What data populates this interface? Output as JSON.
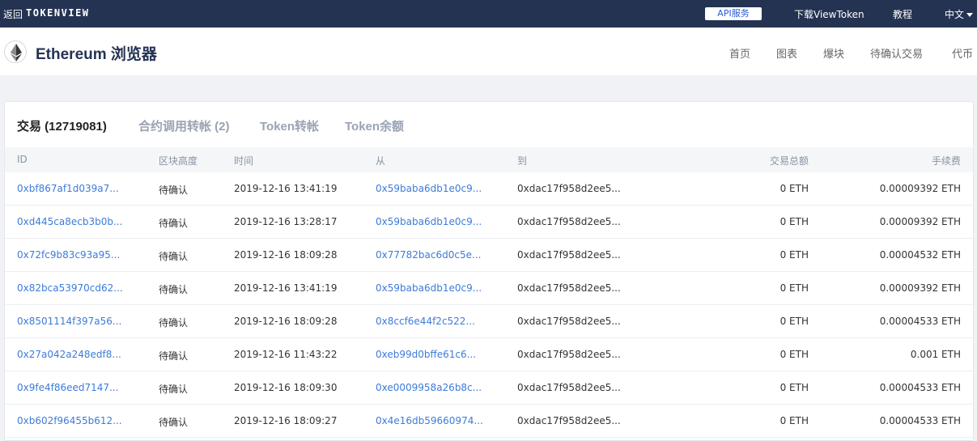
{
  "topbar": {
    "back": "返回",
    "brand": "TOKENVIEW",
    "api": "API服务",
    "download": "下载ViewToken",
    "tutorial": "教程",
    "language": "中文"
  },
  "header": {
    "title": "Ethereum 浏览器",
    "nav": [
      "首页",
      "图表",
      "爆块",
      "待确认交易",
      "代币"
    ]
  },
  "tabs": [
    "交易 (12719081)",
    "合约调用转帐 (2)",
    "Token转帐",
    "Token余额"
  ],
  "table": {
    "columns": [
      "ID",
      "区块高度",
      "时间",
      "从",
      "到",
      "交易总额",
      "手续费"
    ],
    "rows": [
      {
        "id": "0xbf867af1d039a7...",
        "height": "待确认",
        "time": "2019-12-16 13:41:19",
        "from": "0x59baba6db1e0c9...",
        "to": "0xdac17f958d2ee5...",
        "amount": "0 ETH",
        "fee": "0.00009392 ETH"
      },
      {
        "id": "0xd445ca8ecb3b0b...",
        "height": "待确认",
        "time": "2019-12-16 13:28:17",
        "from": "0x59baba6db1e0c9...",
        "to": "0xdac17f958d2ee5...",
        "amount": "0 ETH",
        "fee": "0.00009392 ETH"
      },
      {
        "id": "0x72fc9b83c93a95...",
        "height": "待确认",
        "time": "2019-12-16 18:09:28",
        "from": "0x77782bac6d0c5e...",
        "to": "0xdac17f958d2ee5...",
        "amount": "0 ETH",
        "fee": "0.00004532 ETH"
      },
      {
        "id": "0x82bca53970cd62...",
        "height": "待确认",
        "time": "2019-12-16 13:41:19",
        "from": "0x59baba6db1e0c9...",
        "to": "0xdac17f958d2ee5...",
        "amount": "0 ETH",
        "fee": "0.00009392 ETH"
      },
      {
        "id": "0x8501114f397a56...",
        "height": "待确认",
        "time": "2019-12-16 18:09:28",
        "from": "0x8ccf6e44f2c522...",
        "to": "0xdac17f958d2ee5...",
        "amount": "0 ETH",
        "fee": "0.00004533 ETH"
      },
      {
        "id": "0x27a042a248edf8...",
        "height": "待确认",
        "time": "2019-12-16 11:43:22",
        "from": "0xeb99d0bffe61c6...",
        "to": "0xdac17f958d2ee5...",
        "amount": "0 ETH",
        "fee": "0.001 ETH"
      },
      {
        "id": "0x9fe4f86eed7147...",
        "height": "待确认",
        "time": "2019-12-16 18:09:30",
        "from": "0xe0009958a26b8c...",
        "to": "0xdac17f958d2ee5...",
        "amount": "0 ETH",
        "fee": "0.00004533 ETH"
      },
      {
        "id": "0xb602f96455b612...",
        "height": "待确认",
        "time": "2019-12-16 18:09:27",
        "from": "0x4e16db59660974...",
        "to": "0xdac17f958d2ee5...",
        "amount": "0 ETH",
        "fee": "0.00004533 ETH"
      }
    ]
  }
}
